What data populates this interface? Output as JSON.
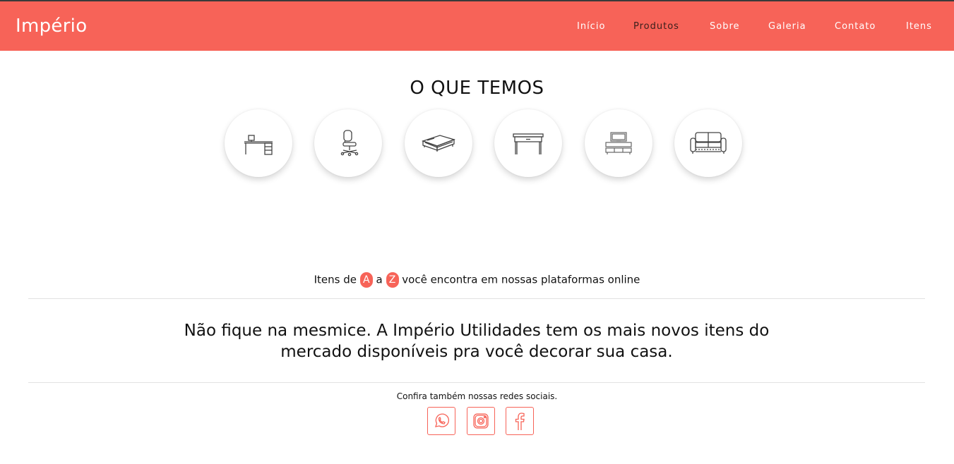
{
  "brand": "Império",
  "nav": {
    "items": [
      {
        "label": "Início"
      },
      {
        "label": "Produtos"
      },
      {
        "label": "Sobre"
      },
      {
        "label": "Galeria"
      },
      {
        "label": "Contato"
      },
      {
        "label": "Itens"
      }
    ],
    "active_index": 1
  },
  "section": {
    "title": "O QUE TEMOS",
    "categories": [
      {
        "icon": "desk-icon"
      },
      {
        "icon": "office-chair-icon"
      },
      {
        "icon": "bed-icon"
      },
      {
        "icon": "console-table-icon"
      },
      {
        "icon": "tv-stand-icon"
      },
      {
        "icon": "sofa-icon"
      }
    ]
  },
  "az": {
    "prefix": "Itens de",
    "letter_a": "A",
    "middle": "a",
    "letter_z": "Z",
    "suffix": "você encontra em nossas plataformas online"
  },
  "promo": {
    "text": "Não fique na mesmice. A Império Utilidades tem os mais novos itens do mercado disponíveis pra você decorar sua casa."
  },
  "social": {
    "caption": "Confira também nossas redes sociais.",
    "icons": [
      "whatsapp-icon",
      "instagram-icon",
      "facebook-icon"
    ]
  },
  "colors": {
    "accent": "#f76358",
    "text": "#111111",
    "active_nav": "#3a1f1c"
  }
}
